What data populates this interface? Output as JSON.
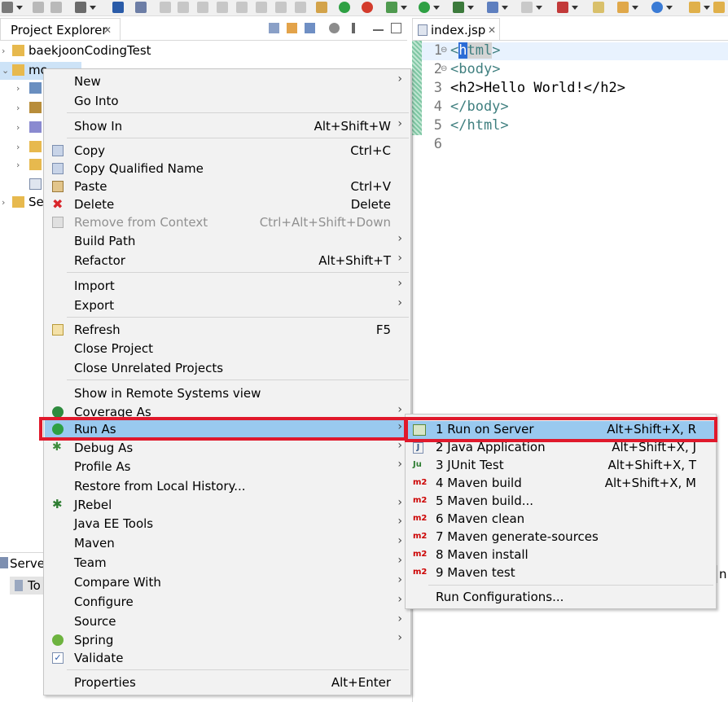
{
  "project_explorer": {
    "title": "Project Explorer",
    "close": "✕",
    "tree": [
      {
        "label": "baekjoonCodingTest",
        "expanded": false
      },
      {
        "label": "mo",
        "expanded": true
      },
      {
        "label": "",
        "expanded": false
      },
      {
        "label": "",
        "expanded": false
      },
      {
        "label": "",
        "expanded": false
      },
      {
        "label": "",
        "expanded": false
      },
      {
        "label": "",
        "expanded": false
      },
      {
        "label": "",
        "expanded": false
      },
      {
        "label": "Ser",
        "expanded": false
      }
    ]
  },
  "editor": {
    "tab_label": "index.jsp",
    "close": "✕",
    "lines": [
      {
        "num": "1",
        "fold": "⊖",
        "open": "<",
        "tag": "html",
        "close": ">",
        "text": ""
      },
      {
        "num": "2",
        "fold": "⊖",
        "open": "<",
        "tag": "body",
        "close": ">",
        "text": ""
      },
      {
        "num": "3",
        "fold": "",
        "text": "<h2>Hello World!</h2>"
      },
      {
        "num": "4",
        "fold": "",
        "text": "</body>"
      },
      {
        "num": "5",
        "fold": "",
        "text": "</html>"
      },
      {
        "num": "6",
        "fold": "",
        "text": ""
      }
    ]
  },
  "servers_panel": {
    "title": "Server",
    "item": "To"
  },
  "right_fragment": "n S",
  "context_menu": {
    "items": [
      {
        "label": "New",
        "accel": "",
        "submenu": true
      },
      {
        "label": "Go Into",
        "accel": ""
      },
      {
        "label": "Show In",
        "accel": "Alt+Shift+W",
        "submenu": true
      },
      {
        "label": "Copy",
        "accel": "Ctrl+C"
      },
      {
        "label": "Copy Qualified Name",
        "accel": ""
      },
      {
        "label": "Paste",
        "accel": "Ctrl+V"
      },
      {
        "label": "Delete",
        "accel": "Delete"
      },
      {
        "label": "Remove from Context",
        "accel": "Ctrl+Alt+Shift+Down",
        "disabled": true
      },
      {
        "label": "Build Path",
        "accel": "",
        "submenu": true
      },
      {
        "label": "Refactor",
        "accel": "Alt+Shift+T",
        "submenu": true
      },
      {
        "label": "Import",
        "accel": "",
        "submenu": true
      },
      {
        "label": "Export",
        "accel": "",
        "submenu": true
      },
      {
        "label": "Refresh",
        "accel": "F5"
      },
      {
        "label": "Close Project",
        "accel": ""
      },
      {
        "label": "Close Unrelated Projects",
        "accel": ""
      },
      {
        "label": "Show in Remote Systems view",
        "accel": ""
      },
      {
        "label": "Coverage As",
        "accel": "",
        "submenu": true
      },
      {
        "label": "Run As",
        "accel": "",
        "submenu": true,
        "highlighted": true
      },
      {
        "label": "Debug As",
        "accel": "",
        "submenu": true
      },
      {
        "label": "Profile As",
        "accel": "",
        "submenu": true
      },
      {
        "label": "Restore from Local History...",
        "accel": ""
      },
      {
        "label": "JRebel",
        "accel": "",
        "submenu": true
      },
      {
        "label": "Java EE Tools",
        "accel": "",
        "submenu": true
      },
      {
        "label": "Maven",
        "accel": "",
        "submenu": true
      },
      {
        "label": "Team",
        "accel": "",
        "submenu": true
      },
      {
        "label": "Compare With",
        "accel": "",
        "submenu": true
      },
      {
        "label": "Configure",
        "accel": "",
        "submenu": true
      },
      {
        "label": "Source",
        "accel": "",
        "submenu": true
      },
      {
        "label": "Spring",
        "accel": "",
        "submenu": true
      },
      {
        "label": "Validate",
        "accel": ""
      },
      {
        "label": "Properties",
        "accel": "Alt+Enter"
      }
    ]
  },
  "run_as_submenu": {
    "items": [
      {
        "label": "1 Run on Server",
        "accel": "Alt+Shift+X, R",
        "icon": "▶",
        "highlighted": true
      },
      {
        "label": "2 Java Application",
        "accel": "Alt+Shift+X, J",
        "icon": "J"
      },
      {
        "label": "3 JUnit Test",
        "accel": "Alt+Shift+X, T",
        "icon": "Ju"
      },
      {
        "label": "4 Maven build",
        "accel": "Alt+Shift+X, M",
        "icon": "m2"
      },
      {
        "label": "5 Maven build...",
        "accel": "",
        "icon": "m2"
      },
      {
        "label": "6 Maven clean",
        "accel": "",
        "icon": "m2"
      },
      {
        "label": "7 Maven generate-sources",
        "accel": "",
        "icon": "m2"
      },
      {
        "label": "8 Maven install",
        "accel": "",
        "icon": "m2"
      },
      {
        "label": "9 Maven test",
        "accel": "",
        "icon": "m2"
      },
      {
        "label": "Run Configurations...",
        "accel": ""
      }
    ]
  },
  "colors": {
    "highlight": "#99c9ef",
    "annotation_box": "#e0192c",
    "menu_bg": "#f2f2f2",
    "tag_color": "#3f7f7f"
  }
}
